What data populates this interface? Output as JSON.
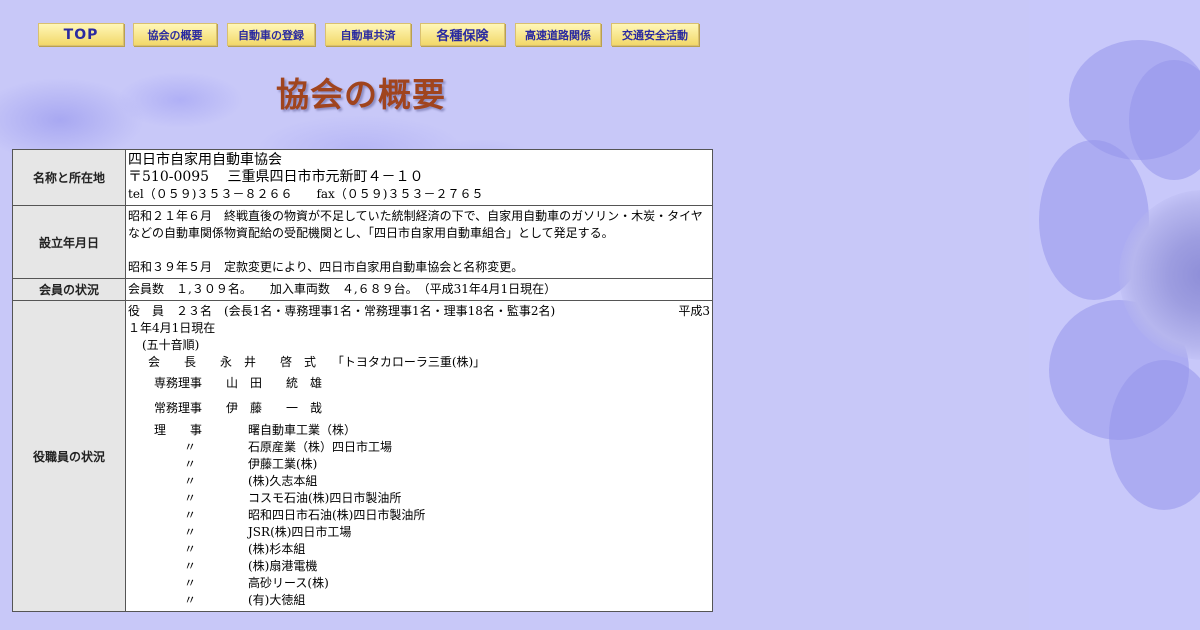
{
  "nav": {
    "items": [
      {
        "label": "TOP"
      },
      {
        "label": "協会の概要"
      },
      {
        "label": "自動車の登録"
      },
      {
        "label": "自動車共済"
      },
      {
        "label": "各種保険"
      },
      {
        "label": "高速道路関係"
      },
      {
        "label": "交通安全活動"
      }
    ]
  },
  "page": {
    "title": "協会の概要"
  },
  "rows": {
    "name": {
      "label": "名称と所在地",
      "name": "四日市自家用自動車協会",
      "address": "〒510-0095　 三重県四日市市元新町４－１０",
      "tel": "tel（０５９)３５３－８２６６　　fax（０５９)３５３－２７６５"
    },
    "founded": {
      "label": "設立年月日",
      "p1": "昭和２１年６月　終戦直後の物資が不足していた統制経済の下で、自家用自動車のガソリン・木炭・タイヤなどの自動車関係物資配給の受配機関とし、「四日市自家用自動車組合」として発足する。",
      "p2": "昭和３９年５月　定款変更により、四日市自家用自動車協会と名称変更。"
    },
    "members": {
      "label": "会員の状況",
      "text": "会員数　１,３０９名。　　加入車両数　４,６８９台。　（平成31年4月1日現在）"
    },
    "officers": {
      "label": "役職員の状況",
      "summary": "役　員　２３名　(会長1名・専務理事1名・常務理事1名・理事18名・監事2名)",
      "date_a": "平成3",
      "date_b": "１年4月1日現在",
      "order": "(五十音順)",
      "chair": "会　　長　　永　井　　啓　式　 「トヨタカローラ三重(株)」",
      "senmu": "専務理事　　山　田　　統　雄",
      "jomu": "常務理事　　伊　藤　　一　哉",
      "riji_title": "理　　事",
      "ditto": "〃",
      "directors": [
        "曙自動車工業（株）",
        "石原産業（株）四日市工場",
        "伊藤工業(株)",
        "(株)久志本組",
        "コスモ石油(株)四日市製油所",
        "昭和四日市石油(株)四日市製油所",
        "JSR(株)四日市工場",
        "(株)杉本組",
        "(株)扇港電機",
        "高砂リース(株)",
        "(有)大徳組"
      ]
    }
  }
}
